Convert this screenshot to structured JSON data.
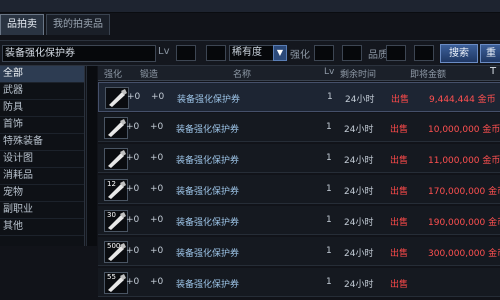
{
  "tabs": [
    {
      "label": "品拍卖",
      "active": true
    },
    {
      "label": "我的拍卖品",
      "active": false
    }
  ],
  "filter": {
    "search_value": "装备强化保护券",
    "level_label": "Lv",
    "quality_value": "稀有度",
    "enhance_label": "强化",
    "grade_label": "品质",
    "search_button": "搜索",
    "reset_button": "重"
  },
  "categories": [
    {
      "label": "全部",
      "active": true
    },
    {
      "label": "武器",
      "active": false
    },
    {
      "label": "防具",
      "active": false
    },
    {
      "label": "首饰",
      "active": false
    },
    {
      "label": "特殊装备",
      "active": false
    },
    {
      "label": "设计图",
      "active": false
    },
    {
      "label": "消耗品",
      "active": false
    },
    {
      "label": "宠物",
      "active": false
    },
    {
      "label": "副职业",
      "active": false
    },
    {
      "label": "其他",
      "active": false
    }
  ],
  "columns": {
    "enhance": "强化",
    "refine": "锻造",
    "name": "名称",
    "level": "Lv",
    "time": "剩余时间",
    "price": "即将金额"
  },
  "rows": [
    {
      "enhance": "+0",
      "refine": "+0",
      "name": "装备强化保护券",
      "level": "1",
      "time": "24小时",
      "seller": "出售",
      "price": "9,444,444 金币",
      "selected": true
    },
    {
      "enhance": "+0",
      "refine": "+0",
      "name": "装备强化保护券",
      "level": "1",
      "time": "24小时",
      "seller": "出售",
      "price": "10,000,000 金币",
      "selected": false
    },
    {
      "enhance": "+0",
      "refine": "+0",
      "name": "装备强化保护券",
      "level": "1",
      "time": "24小时",
      "seller": "出售",
      "price": "11,000,000 金币",
      "selected": false
    },
    {
      "enhance": "+0",
      "refine": "+0",
      "name": "装备强化保护券",
      "level": "1",
      "time": "24小时",
      "seller": "出售",
      "price": "170,000,000 金币",
      "selected": false
    },
    {
      "enhance": "+0",
      "refine": "+0",
      "name": "装备强化保护券",
      "level": "1",
      "time": "24小时",
      "seller": "出售",
      "price": "190,000,000 金币",
      "selected": false
    },
    {
      "enhance": "+0",
      "refine": "+0",
      "name": "装备强化保护券",
      "level": "1",
      "time": "24小时",
      "seller": "出售",
      "price": "300,000,000 金币",
      "selected": false
    },
    {
      "enhance": "+0",
      "refine": "+0",
      "name": "装备强化保护券",
      "level": "1",
      "time": "24小时",
      "seller": "出售",
      "price": "",
      "selected": false
    }
  ],
  "icon_badges": [
    "",
    "",
    "",
    "12",
    "30",
    "500",
    "55"
  ],
  "colors": {
    "seller": "#ff4a4a",
    "price": "#ff5050",
    "accent": "#3c5f99"
  }
}
